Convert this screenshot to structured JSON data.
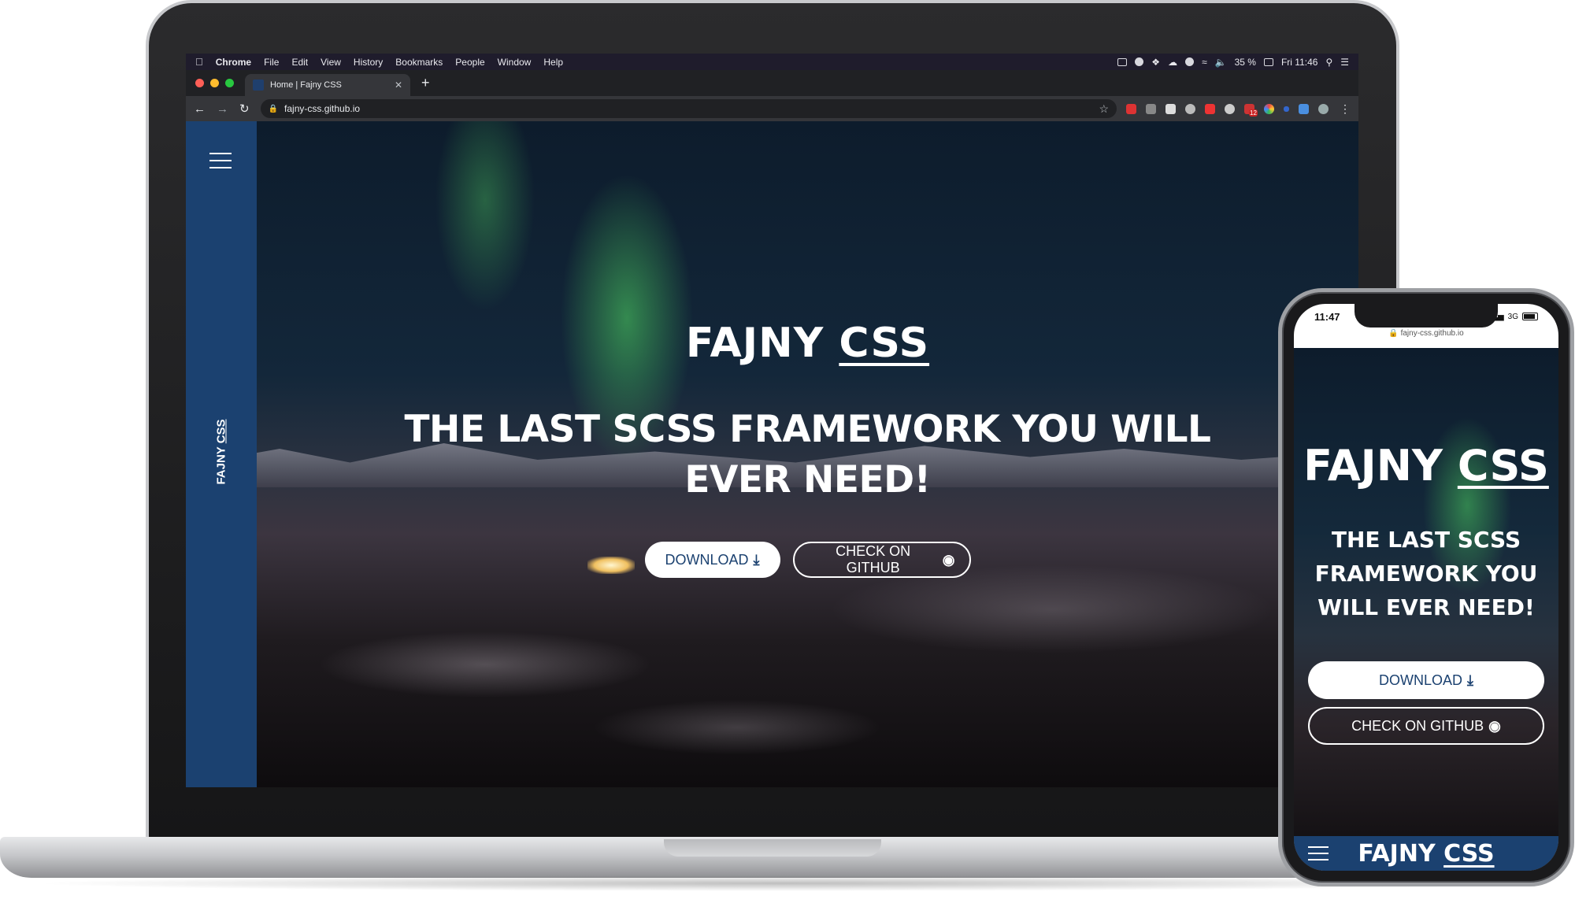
{
  "menubar": {
    "items": [
      "Chrome",
      "File",
      "Edit",
      "View",
      "History",
      "Bookmarks",
      "People",
      "Window",
      "Help"
    ],
    "battery": "35 %",
    "clock": "Fri 11:46"
  },
  "browser": {
    "tab_title": "Home | Fajny CSS",
    "url": "fajny-css.github.io",
    "extension_badge": "12"
  },
  "site": {
    "brand_first": "FAJNY",
    "brand_second": "CSS",
    "sidebar_brand_first": "FAJNY",
    "sidebar_brand_second": "CSS",
    "tagline": "THE LAST SCSS FRAMEWORK YOU WILL EVER NEED!",
    "download_label": "DOWNLOAD",
    "github_label": "CHECK ON GITHUB"
  },
  "phone": {
    "time": "11:47",
    "network": "3G",
    "url": "fajny-css.github.io"
  },
  "colors": {
    "brand_blue": "#1b4170",
    "menubar": "#1f1c2c",
    "chrome_dark": "#202124"
  }
}
